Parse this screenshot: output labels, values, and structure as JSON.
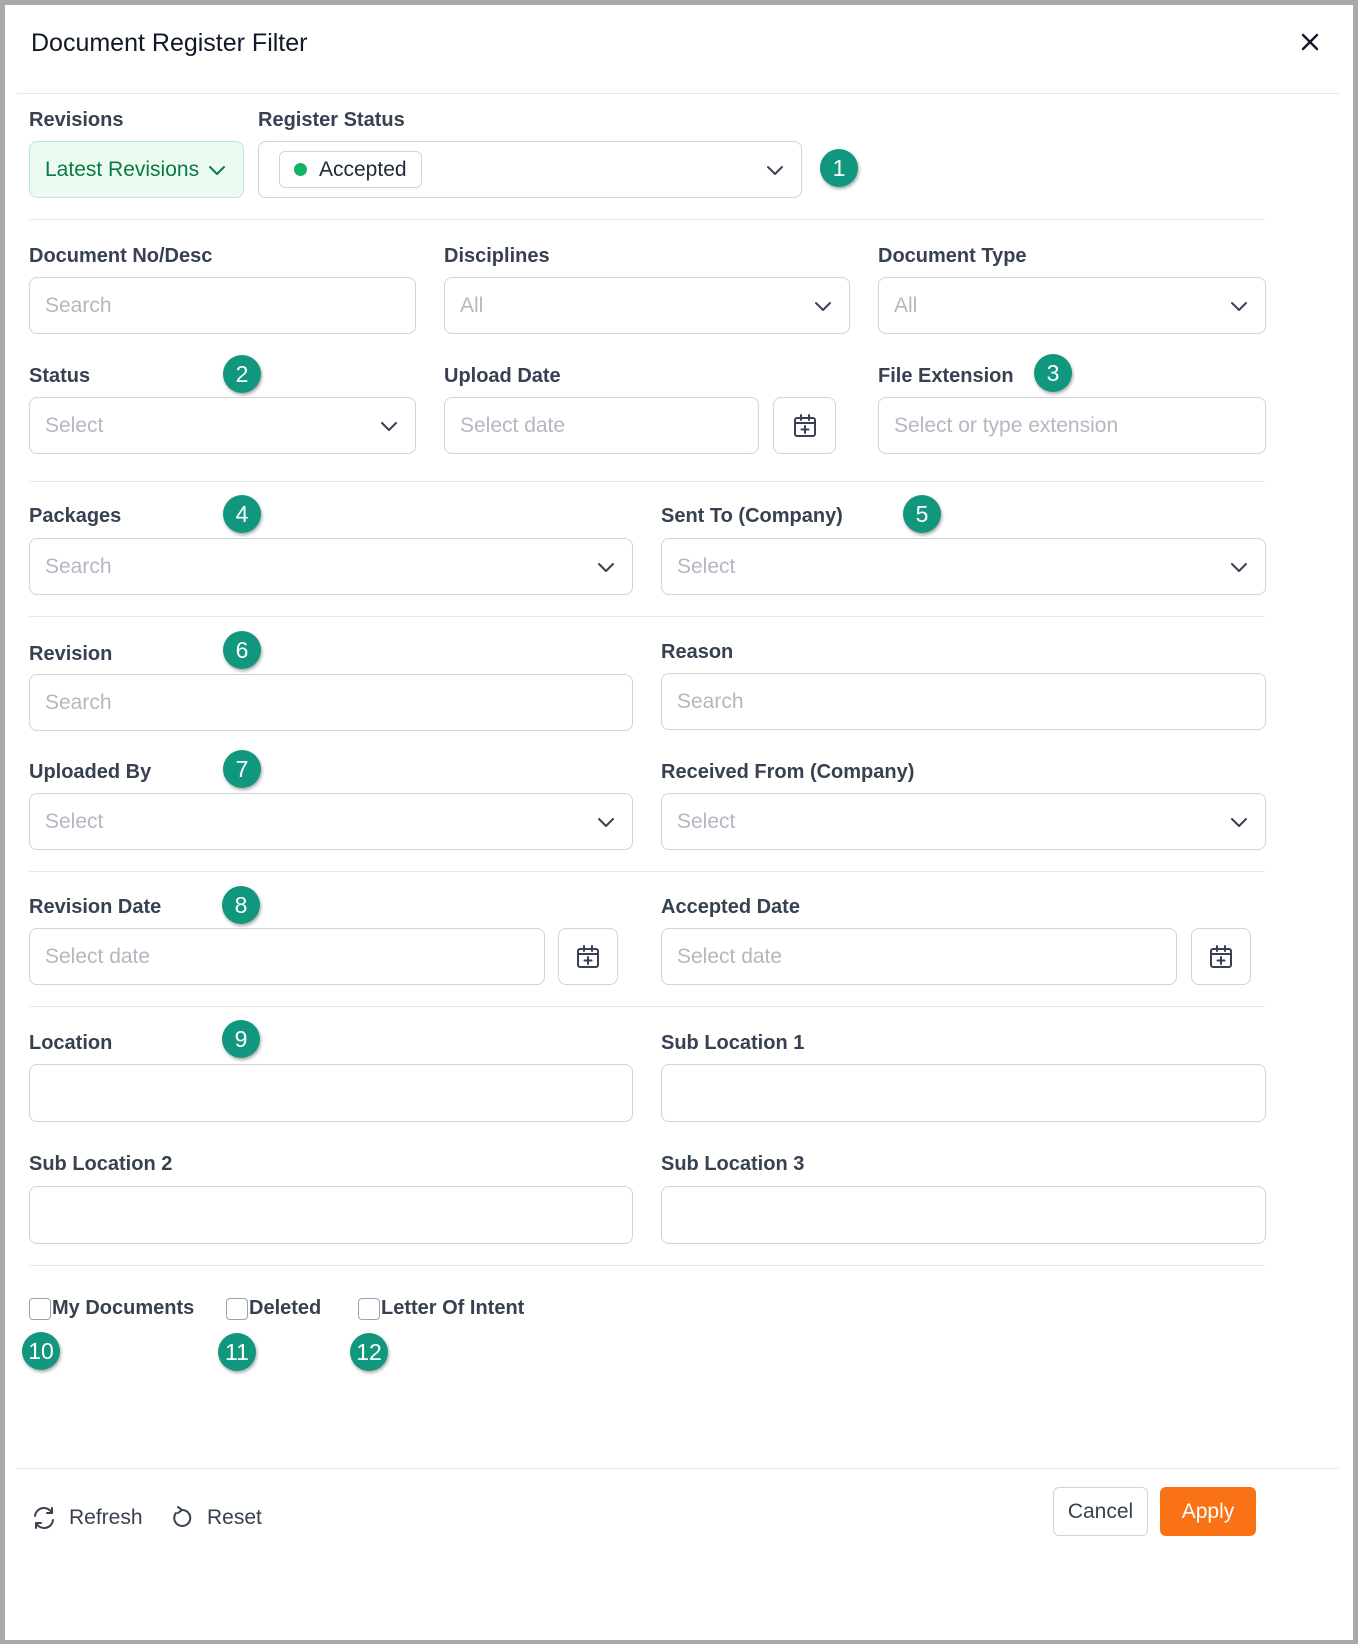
{
  "dialog": {
    "title": "Document Register Filter"
  },
  "revisions": {
    "label": "Revisions",
    "value": "Latest Revisions"
  },
  "register_status": {
    "label": "Register Status",
    "chip": "Accepted",
    "chip_color": "#16b364"
  },
  "document_no": {
    "label": "Document No/Desc",
    "placeholder": "Search"
  },
  "disciplines": {
    "label": "Disciplines",
    "placeholder": "All"
  },
  "document_type": {
    "label": "Document Type",
    "placeholder": "All"
  },
  "status": {
    "label": "Status",
    "placeholder": "Select"
  },
  "upload_date": {
    "label": "Upload Date",
    "placeholder": "Select date"
  },
  "file_extension": {
    "label": "File Extension",
    "placeholder": "Select or type extension"
  },
  "packages": {
    "label": "Packages",
    "placeholder": "Search"
  },
  "sent_to": {
    "label": "Sent To (Company)",
    "placeholder": "Select"
  },
  "revision": {
    "label": "Revision",
    "placeholder": "Search"
  },
  "reason": {
    "label": "Reason",
    "placeholder": "Search"
  },
  "uploaded_by": {
    "label": "Uploaded By",
    "placeholder": "Select"
  },
  "received_from": {
    "label": "Received From (Company)",
    "placeholder": "Select"
  },
  "revision_date": {
    "label": "Revision Date",
    "placeholder": "Select date"
  },
  "accepted_date": {
    "label": "Accepted Date",
    "placeholder": "Select date"
  },
  "location": {
    "label": "Location",
    "value": ""
  },
  "sub_location_1": {
    "label": "Sub Location 1",
    "value": ""
  },
  "sub_location_2": {
    "label": "Sub Location 2",
    "value": ""
  },
  "sub_location_3": {
    "label": "Sub Location 3",
    "value": ""
  },
  "checkboxes": [
    {
      "label": "My Documents",
      "checked": false
    },
    {
      "label": "Deleted",
      "checked": false
    },
    {
      "label": "Letter Of Intent",
      "checked": false
    }
  ],
  "annotations": [
    "1",
    "2",
    "3",
    "4",
    "5",
    "6",
    "7",
    "8",
    "9",
    "10",
    "11",
    "12"
  ],
  "annotation_color": "#11977d",
  "footer": {
    "refresh_label": "Refresh",
    "reset_label": "Reset",
    "cancel_label": "Cancel",
    "apply_label": "Apply",
    "apply_color": "#f97316"
  }
}
